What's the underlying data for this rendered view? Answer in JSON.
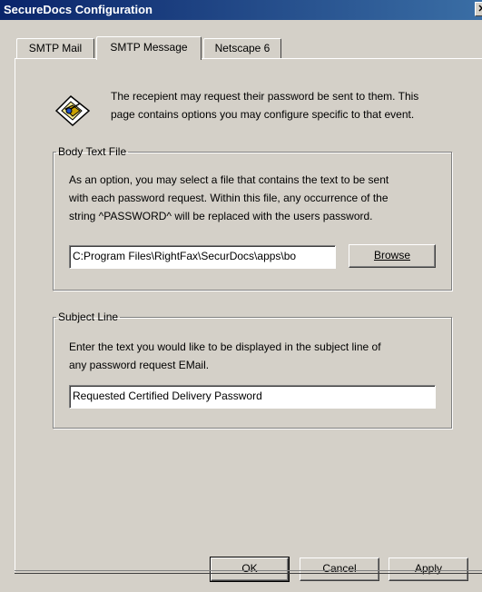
{
  "window": {
    "title": "SecureDocs Configuration"
  },
  "tabs": [
    {
      "label": "SMTP Mail",
      "active": false
    },
    {
      "label": "SMTP Message",
      "active": true
    },
    {
      "label": "Netscape 6",
      "active": false
    }
  ],
  "intro": {
    "icon": "password-request-icon",
    "line1": "The recepient may request their password be sent to them. This",
    "line2": "page contains options you may configure specific to that event."
  },
  "body_text_file": {
    "legend": "Body Text File",
    "line1": "As an option, you may select a file that contains the text to be sent",
    "line2": "with each password request. Within this file, any occurrence of the",
    "line3": "string ^PASSWORD^ will be replaced with the users password.",
    "path_value": "C:Program Files\\RightFax\\SecurDocs\\apps\\bo",
    "browse_label": "Browse"
  },
  "subject_line": {
    "legend": "Subject Line",
    "line1": "Enter the text you would like to be displayed in the subject line of",
    "line2": "any password request EMail.",
    "value": "Requested Certified Delivery Password"
  },
  "footer": {
    "ok_label": "OK",
    "cancel_label": "Cancel",
    "apply_label": "Apply"
  }
}
